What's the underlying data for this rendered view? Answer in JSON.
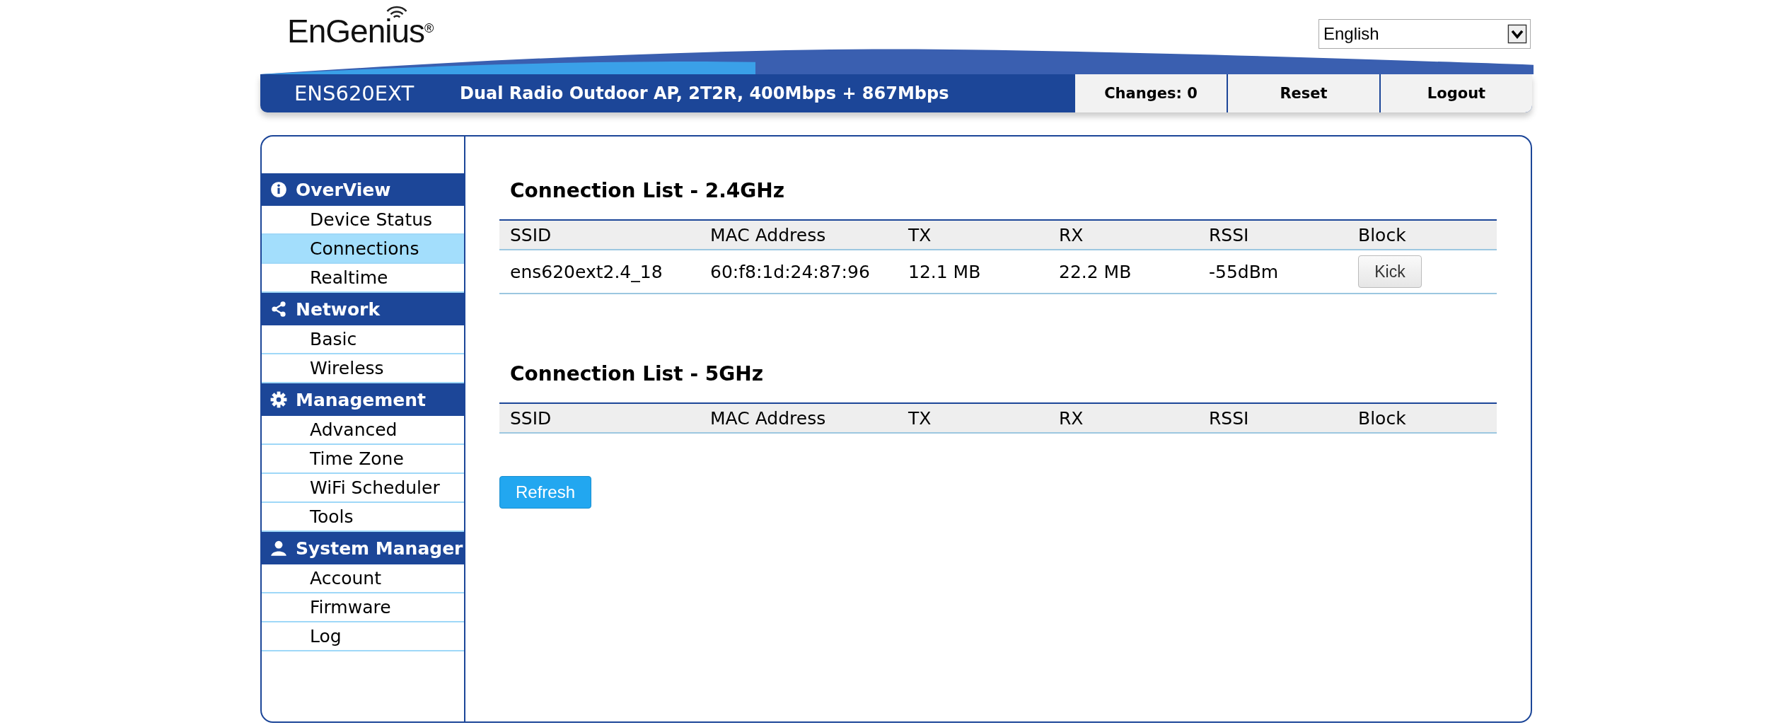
{
  "header": {
    "logo": "EnGenius",
    "logo_mark": "®",
    "language": "English",
    "model": "ENS620EXT",
    "tagline": "Dual Radio Outdoor AP, 2T2R, 400Mbps + 867Mbps",
    "buttons": [
      "Changes: 0",
      "Reset",
      "Logout"
    ]
  },
  "sidebar": {
    "groups": [
      {
        "title": "OverView",
        "kind": "info",
        "items": [
          {
            "label": "Device Status",
            "selected": false
          },
          {
            "label": "Connections",
            "selected": true
          },
          {
            "label": "Realtime",
            "selected": false
          }
        ]
      },
      {
        "title": "Network",
        "kind": "share",
        "items": [
          {
            "label": "Basic",
            "selected": false
          },
          {
            "label": "Wireless",
            "selected": false
          }
        ]
      },
      {
        "title": "Management",
        "kind": "gear",
        "items": [
          {
            "label": "Advanced",
            "selected": false
          },
          {
            "label": "Time Zone",
            "selected": false
          },
          {
            "label": "WiFi Scheduler",
            "selected": false
          },
          {
            "label": "Tools",
            "selected": false
          }
        ]
      },
      {
        "title": "System Manager",
        "kind": "user",
        "items": [
          {
            "label": "Account",
            "selected": false
          },
          {
            "label": "Firmware",
            "selected": false
          },
          {
            "label": "Log",
            "selected": false
          }
        ]
      }
    ]
  },
  "tables": [
    {
      "title": "Connection List - 2.4GHz",
      "columns": [
        "SSID",
        "MAC Address",
        "TX",
        "RX",
        "RSSI",
        "Block"
      ],
      "rows": [
        {
          "cells": [
            "ens620ext2.4_18",
            "60:f8:1d:24:87:96",
            "12.1 MB",
            "22.2 MB",
            "-55dBm"
          ],
          "action": "Kick"
        }
      ]
    },
    {
      "title": "Connection List - 5GHz",
      "columns": [
        "SSID",
        "MAC Address",
        "TX",
        "RX",
        "RSSI",
        "Block"
      ]
    }
  ],
  "refresh_button": "Refresh"
}
